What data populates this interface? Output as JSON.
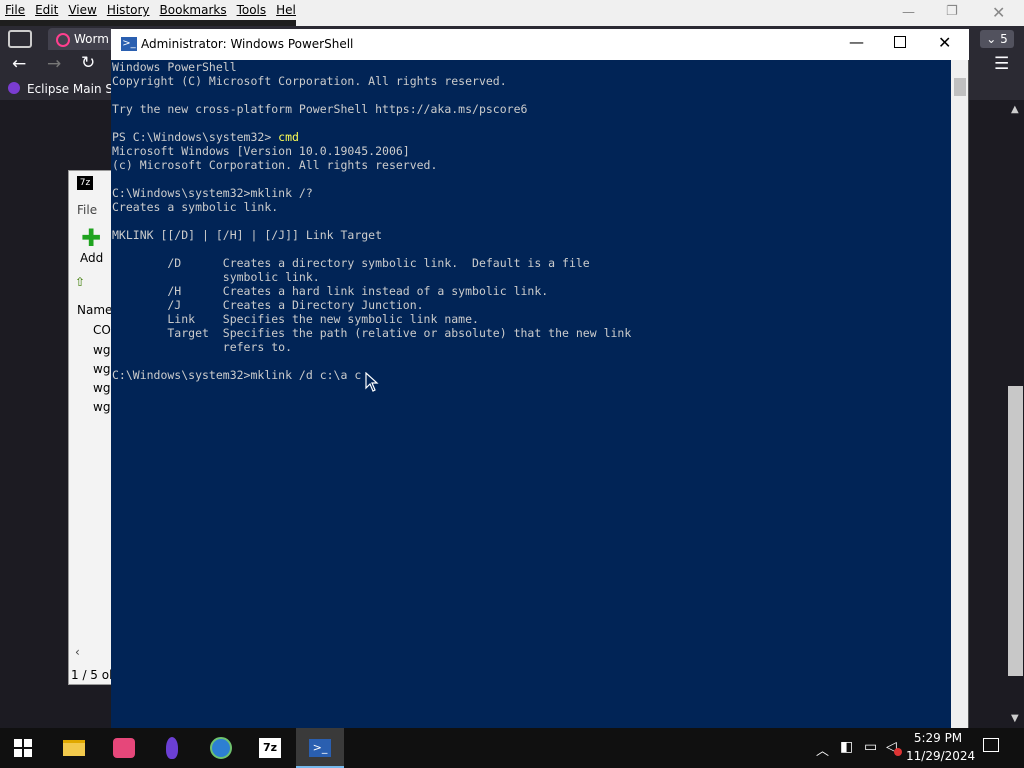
{
  "browser": {
    "menu": [
      "File",
      "Edit",
      "View",
      "History",
      "Bookmarks",
      "Tools",
      "Help"
    ],
    "tab_title": "Worm",
    "tab_count": "5",
    "bookmark": "Eclipse Main Site"
  },
  "sevenzip": {
    "menu_file": "File",
    "add_label": "Add",
    "column_name": "Name",
    "files": [
      "CO",
      "wg",
      "wg",
      "wg",
      "wg"
    ],
    "status": "1 / 5 ob"
  },
  "powershell": {
    "title": "Administrator: Windows PowerShell",
    "lines": [
      "Windows PowerShell",
      "Copyright (C) Microsoft Corporation. All rights reserved.",
      "",
      "Try the new cross-platform PowerShell https://aka.ms/pscore6",
      "",
      "PS C:\\Windows\\system32> ",
      "Microsoft Windows [Version 10.0.19045.2006]",
      "(c) Microsoft Corporation. All rights reserved.",
      "",
      "C:\\Windows\\system32>mklink /?",
      "Creates a symbolic link.",
      "",
      "MKLINK [[/D] | [/H] | [/J]] Link Target",
      "",
      "        /D      Creates a directory symbolic link.  Default is a file",
      "                symbolic link.",
      "        /H      Creates a hard link instead of a symbolic link.",
      "        /J      Creates a Directory Junction.",
      "        Link    Specifies the new symbolic link name.",
      "        Target  Specifies the path (relative or absolute) that the new link",
      "                refers to.",
      "",
      "C:\\Windows\\system32>mklink /d c:\\a c"
    ],
    "ps_command": "cmd"
  },
  "taskbar": {
    "time": "5:29 PM",
    "date": "11/29/2024",
    "apps": [
      "file-explorer-icon",
      "wps-icon",
      "eclipse-icon",
      "network-globe-icon",
      "7zip-icon",
      "powershell-icon"
    ]
  },
  "colors": {
    "console_bg": "#012456",
    "console_fg": "#cccccc",
    "console_yellow": "#ffff55"
  }
}
